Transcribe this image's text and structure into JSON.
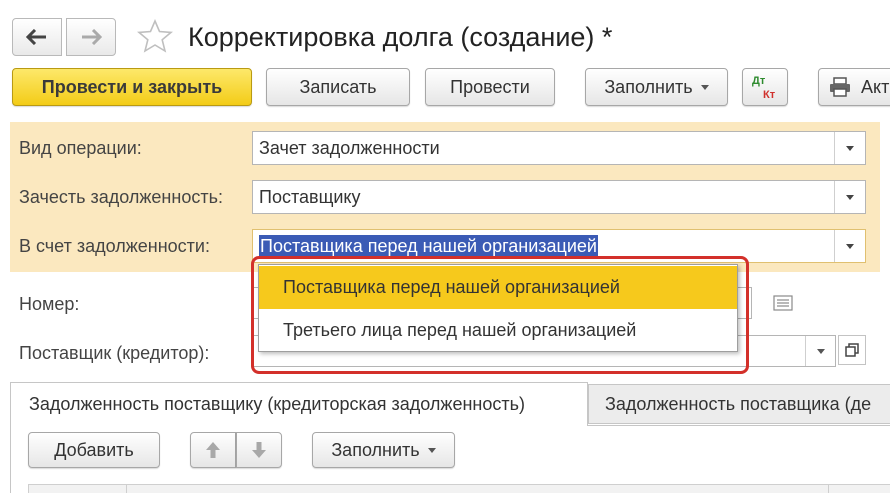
{
  "window": {
    "title": "Корректировка долга (создание) *"
  },
  "toolbar": {
    "post_and_close": "Провести и закрыть",
    "save": "Записать",
    "post": "Провести",
    "fill": "Заполнить",
    "dt": "Дт",
    "kt": "Кт",
    "print_partial": "Акт"
  },
  "params": {
    "operation_label": "Вид операции:",
    "operation_value": "Зачет задолженности",
    "offset_label": "Зачесть задолженность:",
    "offset_value": "Поставщику",
    "against_label": "В счет задолженности:",
    "against_value": "Поставщика перед нашей организацией"
  },
  "form": {
    "number_label": "Номер:",
    "supplier_label": "Поставщик (кредитор):"
  },
  "dropdown": {
    "options": [
      "Поставщика перед нашей организацией",
      "Третьего лица перед нашей организацией"
    ],
    "highlighted_index": 0
  },
  "tabs": [
    {
      "label": "Задолженность поставщику (кредиторская задолженность)",
      "active": true
    },
    {
      "label": "Задолженность поставщика (де",
      "active": false
    }
  ],
  "table_toolbar": {
    "add": "Добавить",
    "fill": "Заполнить"
  },
  "colors": {
    "primary_button": "#f3cc17",
    "panel_background": "#fbe8bf",
    "dropdown_highlight": "#f6c91c",
    "annotation_outline": "#d3302a",
    "selection": "#3b5bb5"
  }
}
